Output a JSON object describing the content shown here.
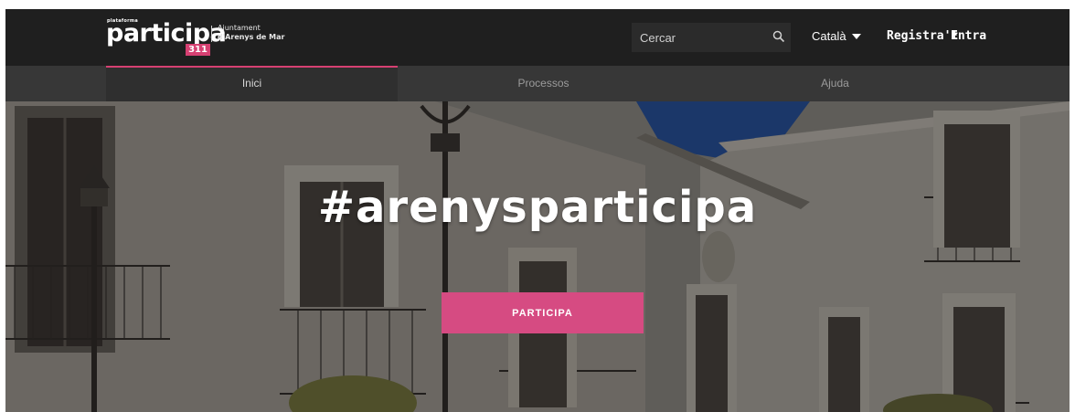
{
  "header": {
    "logo": {
      "small_text": "plataforma",
      "word": "participa",
      "number": "311"
    },
    "org": {
      "line1": "Ajuntament",
      "line2": "d'Arenys de Mar"
    },
    "search": {
      "placeholder": "Cercar",
      "icon": "search-icon"
    },
    "language": "Català",
    "register_label": "Registra't",
    "login_label": "Entra"
  },
  "nav": {
    "tabs": [
      {
        "label": "Inici",
        "active": true
      },
      {
        "label": "Processos",
        "active": false
      },
      {
        "label": "Ajuda",
        "active": false
      }
    ]
  },
  "hero": {
    "title": "#arenysparticipa",
    "cta_label": "PARTICIPA"
  },
  "colors": {
    "topbar": "#1f1f1f",
    "nav": "#373737",
    "accent": "#d64072",
    "cta": "#d64b82"
  }
}
